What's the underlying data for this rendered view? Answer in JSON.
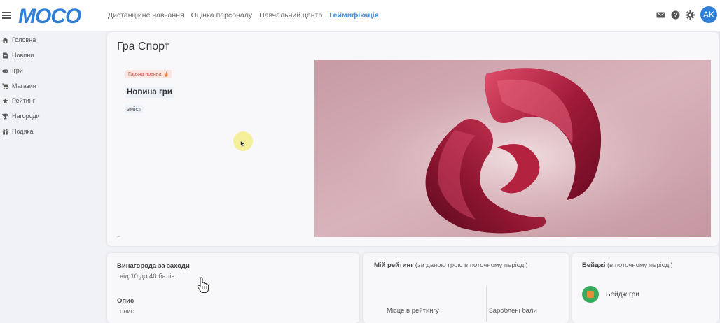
{
  "header": {
    "logo_text": "MOCO",
    "nav": [
      {
        "label": "Дистанційне навчання",
        "active": false
      },
      {
        "label": "Оцінка персоналу",
        "active": false
      },
      {
        "label": "Навчальний центр",
        "active": false
      },
      {
        "label": "Геймифікація",
        "active": true
      }
    ],
    "icons": [
      "mail-icon",
      "help-icon",
      "settings-icon"
    ],
    "avatar_initials": "AK"
  },
  "sidebar": {
    "items": [
      {
        "label": "Головна",
        "icon": "home-icon"
      },
      {
        "label": "Новини",
        "icon": "news-icon"
      },
      {
        "label": "Ігри",
        "icon": "games-icon"
      },
      {
        "label": "Магазин",
        "icon": "cart-icon"
      },
      {
        "label": "Рейтинг",
        "icon": "star-icon"
      },
      {
        "label": "Нагороди",
        "icon": "trophy-icon"
      },
      {
        "label": "Подяка",
        "icon": "gift-icon"
      }
    ]
  },
  "game": {
    "title": "Гра Спорт",
    "news_badge": "Гаряча новина",
    "news_title": "Новина гри",
    "news_content": "зміст",
    "image_name": "game-banner-image"
  },
  "award": {
    "title": "Винагорода за заходи",
    "range": "від 10 до 40 балів",
    "description_title": "Опис",
    "description_text": "опис"
  },
  "rating": {
    "title_bold": "Мій рейтинг",
    "title_rest": " (за даною грою в поточному періоді)",
    "col_place": "Місце в рейтингу",
    "col_points": "Зароблені бали"
  },
  "badges": {
    "title_bold": "Бейджі",
    "title_rest": " (в поточному періоді)",
    "items": [
      {
        "label": "Бейдж гри"
      }
    ]
  },
  "colors": {
    "brand": "#2f7fd8",
    "active_nav": "#4a90d9",
    "badge_bg": "#fbe5e0",
    "badge_text": "#d4544a",
    "badge_green": "#3aab5c"
  }
}
